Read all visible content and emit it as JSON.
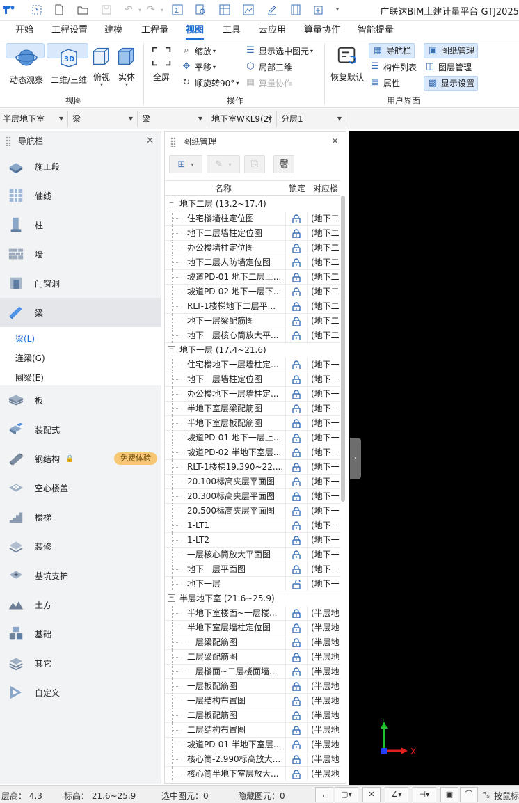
{
  "title_bar": {
    "app_title": "广联达BIM土建计量平台 GTJ2025",
    "quick_access_icons": [
      "app-logo-icon",
      "select-icon",
      "new-file-icon",
      "open-folder-icon",
      "save-icon",
      "undo-icon",
      "redo-icon",
      "sum-icon",
      "query-icon",
      "table-icon",
      "image-icon",
      "edit-icon",
      "film-icon",
      "add-icon",
      "more-icon"
    ]
  },
  "menu": {
    "tabs": [
      "开始",
      "工程设置",
      "建模",
      "工程量",
      "视图",
      "工具",
      "云应用",
      "算量协作",
      "智能提量"
    ],
    "active": "视图"
  },
  "ribbon": {
    "groups": {
      "view": {
        "label": "视图",
        "buttons": [
          "动态观察",
          "二维/三维",
          "俯视",
          "实体"
        ],
        "selected": [
          "动态观察",
          "二维/三维"
        ]
      },
      "operate": {
        "label": "操作",
        "fullscreen": "全屏",
        "zoom": "缩放",
        "pan": "平移",
        "rotate": "顺旋转90°",
        "show_selected": "显示选中图元",
        "local_3d": "局部三维",
        "collab": "算量协作"
      },
      "ui": {
        "label": "用户界面",
        "restore": "恢复默认",
        "navbar": "导航栏",
        "component_list": "构件列表",
        "properties": "属性",
        "drawing_mgmt": "图纸管理",
        "layer_mgmt": "图层管理",
        "display_settings": "显示设置"
      }
    }
  },
  "selectors": [
    "半层地下室",
    "梁",
    "梁",
    "地下室WKL9(2)",
    "分层1"
  ],
  "left_nav": {
    "title": "导航栏",
    "items": [
      {
        "label": "施工段",
        "icon": "construction-section-icon"
      },
      {
        "label": "轴线",
        "icon": "axis-grid-icon"
      },
      {
        "label": "柱",
        "icon": "column-icon"
      },
      {
        "label": "墙",
        "icon": "wall-icon"
      },
      {
        "label": "门窗洞",
        "icon": "door-window-icon"
      },
      {
        "label": "梁",
        "icon": "beam-icon"
      },
      {
        "label": "板",
        "icon": "slab-icon"
      },
      {
        "label": "装配式",
        "icon": "prefab-icon"
      },
      {
        "label": "钢结构",
        "icon": "steel-structure-icon"
      },
      {
        "label": "空心楼盖",
        "icon": "hollow-floor-icon"
      },
      {
        "label": "楼梯",
        "icon": "stairs-icon"
      },
      {
        "label": "装修",
        "icon": "decoration-icon"
      },
      {
        "label": "基坑支护",
        "icon": "foundation-pit-icon"
      },
      {
        "label": "土方",
        "icon": "earthwork-icon"
      },
      {
        "label": "基础",
        "icon": "foundation-icon"
      },
      {
        "label": "其它",
        "icon": "other-icon"
      },
      {
        "label": "自定义",
        "icon": "custom-icon"
      }
    ],
    "active": "梁",
    "sub_items": [
      "梁(L)",
      "连梁(G)",
      "圈梁(E)"
    ],
    "active_sub": "梁(L)",
    "trial_badge": "免费体验"
  },
  "drawing_panel": {
    "title": "图纸管理",
    "columns": [
      "名称",
      "锁定",
      "对应楼"
    ],
    "groups": [
      {
        "name": "地下二层 (13.2~17.4)",
        "rows": [
          {
            "name": "住宅楼墙柱定位图",
            "floor": "(地下二"
          },
          {
            "name": "地下二层墙柱定位图",
            "floor": "(地下二"
          },
          {
            "name": "办公楼墙柱定位图",
            "floor": "(地下二"
          },
          {
            "name": "地下二层人防墙定位图",
            "floor": "(地下二"
          },
          {
            "name": "坡道PD-01 地下二层上...",
            "floor": "(地下二"
          },
          {
            "name": "坡道PD-02 地下一层下...",
            "floor": "(地下二"
          },
          {
            "name": "RLT-1楼梯地下二层平...",
            "floor": "(地下二"
          },
          {
            "name": "地下一层梁配筋图",
            "floor": "(地下二"
          },
          {
            "name": "地下一层核心筒放大平...",
            "floor": "(地下二"
          }
        ]
      },
      {
        "name": "地下一层 (17.4~21.6)",
        "rows": [
          {
            "name": "住宅楼地下一层墙柱定...",
            "floor": "(地下一"
          },
          {
            "name": "地下一层墙柱定位图",
            "floor": "(地下一"
          },
          {
            "name": "办公楼地下一层墙柱定...",
            "floor": "(地下一"
          },
          {
            "name": "半地下室层梁配筋图",
            "floor": "(地下一"
          },
          {
            "name": "半地下室层板配筋图",
            "floor": "(地下一"
          },
          {
            "name": "坡道PD-01 地下一层上...",
            "floor": "(地下一"
          },
          {
            "name": "坡道PD-02 半地下室层...",
            "floor": "(地下一"
          },
          {
            "name": "RLT-1楼梯19.390~22....",
            "floor": "(地下一"
          },
          {
            "name": "20.100标高夹层平面图",
            "floor": "(地下一"
          },
          {
            "name": "20.300标高夹层平面图",
            "floor": "(地下一"
          },
          {
            "name": "20.500标高夹层平面图",
            "floor": "(地下一"
          },
          {
            "name": "1-LT1",
            "floor": "(地下一"
          },
          {
            "name": "1-LT2",
            "floor": "(地下一"
          },
          {
            "name": "一层核心筒放大平面图",
            "floor": "(地下一"
          },
          {
            "name": "地下一层平面图",
            "floor": "(地下一"
          },
          {
            "name": "地下一层",
            "floor": "(地下一",
            "unlocked": true
          }
        ]
      },
      {
        "name": "半层地下室 (21.6~25.9)",
        "rows": [
          {
            "name": "半地下室楼面~一层楼...",
            "floor": "(半层地"
          },
          {
            "name": "半地下室层墙柱定位图",
            "floor": "(半层地"
          },
          {
            "name": "一层梁配筋图",
            "floor": "(半层地"
          },
          {
            "name": "二层梁配筋图",
            "floor": "(半层地"
          },
          {
            "name": "一层楼面~二层楼面墙...",
            "floor": "(半层地"
          },
          {
            "name": "一层板配筋图",
            "floor": "(半层地"
          },
          {
            "name": "一层结构布置图",
            "floor": "(半层地"
          },
          {
            "name": "二层板配筋图",
            "floor": "(半层地"
          },
          {
            "name": "二层结构布置图",
            "floor": "(半层地"
          },
          {
            "name": "坡道PD-01 半地下室层...",
            "floor": "(半层地"
          },
          {
            "name": "核心筒-2.990标高放大...",
            "floor": "(半层地"
          },
          {
            "name": "核心筒半地下室层放大...",
            "floor": "(半层地"
          }
        ]
      }
    ]
  },
  "viewport": {
    "axis_y": "Y",
    "axis_x": "X"
  },
  "status_bar": {
    "layer_height": "层高：  4.3",
    "elevation": "标高：  21.6~25.9",
    "selected": "选中图元：0",
    "hidden": "隐藏图元：0",
    "right_label": "按鼠标"
  },
  "colors": {
    "accent": "#1e6fd6",
    "selected_bg": "#d9e8fb",
    "viewport_bg": "#000000",
    "trial_badge": "#f7c775"
  }
}
